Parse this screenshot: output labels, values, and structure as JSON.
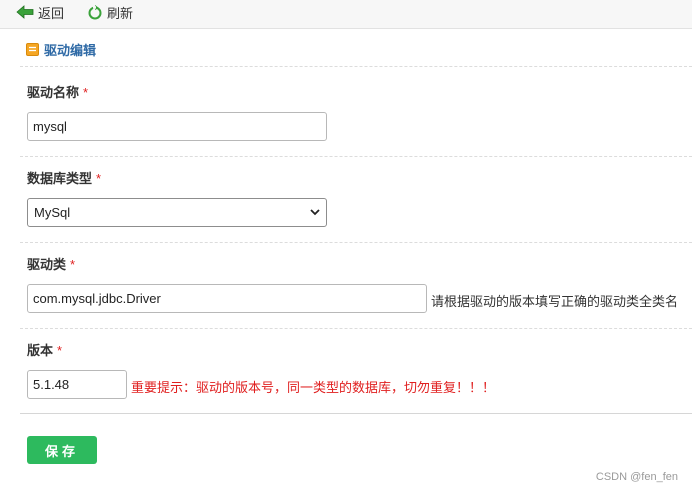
{
  "toolbar": {
    "back_label": "返回",
    "refresh_label": "刷新",
    "back_icon": "arrow-left-icon",
    "refresh_icon": "refresh-icon"
  },
  "section": {
    "title": "驱动编辑",
    "icon": "edit-note-icon"
  },
  "form": {
    "required_mark": "*",
    "driver_name": {
      "label": "驱动名称",
      "value": "mysql"
    },
    "db_type": {
      "label": "数据库类型",
      "selected": "MySql"
    },
    "driver_class": {
      "label": "驱动类",
      "value": "com.mysql.jdbc.Driver",
      "hint": "请根据驱动的版本填写正确的驱动类全类名"
    },
    "version": {
      "label": "版本",
      "value": "5.1.48",
      "warning": "重要提示：驱动的版本号，同一类型的数据库，切勿重复！！！"
    },
    "save_label": "保存"
  },
  "watermark": "CSDN @fen_fen",
  "colors": {
    "accent": "#2f6aa6",
    "save": "#2dba5e",
    "required": "#e02020",
    "warning": "#e02020"
  }
}
